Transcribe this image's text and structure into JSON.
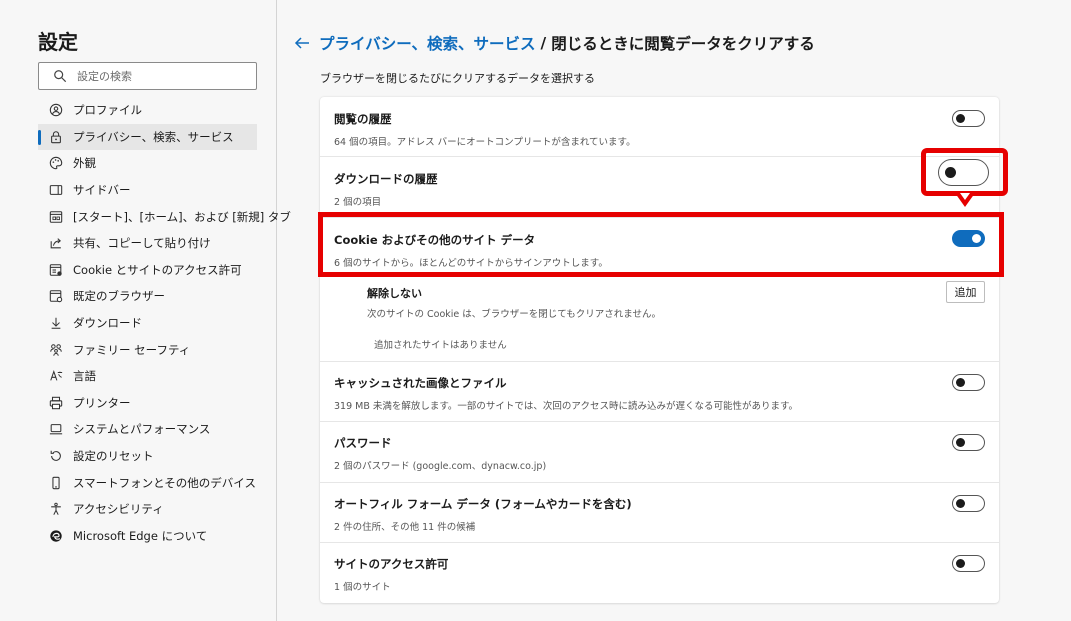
{
  "sidebar": {
    "title": "設定",
    "search_placeholder": "設定の検索",
    "items": [
      {
        "label": "プロファイル",
        "icon": "profile-icon"
      },
      {
        "label": "プライバシー、検索、サービス",
        "icon": "lock-icon",
        "active": true
      },
      {
        "label": "外観",
        "icon": "palette-icon"
      },
      {
        "label": "サイドバー",
        "icon": "sidebar-icon"
      },
      {
        "label": "[スタート]、[ホーム]、および [新規] タブ",
        "icon": "home-tab-icon"
      },
      {
        "label": "共有、コピーして貼り付け",
        "icon": "share-icon"
      },
      {
        "label": "Cookie とサイトのアクセス許可",
        "icon": "site-permissions-icon"
      },
      {
        "label": "既定のブラウザー",
        "icon": "browser-icon"
      },
      {
        "label": "ダウンロード",
        "icon": "download-icon"
      },
      {
        "label": "ファミリー セーフティ",
        "icon": "family-icon"
      },
      {
        "label": "言語",
        "icon": "language-icon"
      },
      {
        "label": "プリンター",
        "icon": "printer-icon"
      },
      {
        "label": "システムとパフォーマンス",
        "icon": "laptop-icon"
      },
      {
        "label": "設定のリセット",
        "icon": "reset-icon"
      },
      {
        "label": "スマートフォンとその他のデバイス",
        "icon": "phone-icon"
      },
      {
        "label": "アクセシビリティ",
        "icon": "accessibility-icon"
      },
      {
        "label": "Microsoft Edge について",
        "icon": "edge-icon"
      }
    ]
  },
  "header": {
    "breadcrumb_link": "プライバシー、検索、サービス",
    "separator": "/",
    "current": "閉じるときに閲覧データをクリアする"
  },
  "subtitle": "ブラウザーを閉じるたびにクリアするデータを選択する",
  "rows": [
    {
      "title": "閲覧の履歴",
      "desc": "64 個の項目。アドレス バーにオートコンプリートが含まれています。",
      "on": false
    },
    {
      "title": "ダウンロードの履歴",
      "desc": "2 個の項目",
      "on": false
    },
    {
      "title": "Cookie およびその他のサイト データ",
      "desc": "6 個のサイトから。ほとんどのサイトからサインアウトします。",
      "on": true
    },
    {
      "title": "キャッシュされた画像とファイル",
      "desc": "319 MB 未満を解放します。一部のサイトでは、次回のアクセス時に読み込みが遅くなる可能性があります。",
      "on": false
    },
    {
      "title": "パスワード",
      "desc": "2 個のパスワード (google.com、dynacw.co.jp)",
      "on": false
    },
    {
      "title": "オートフィル フォーム データ (フォームやカードを含む)",
      "desc": "2 件の住所、その他 11 件の候補",
      "on": false
    },
    {
      "title": "サイトのアクセス許可",
      "desc": "1 個のサイト",
      "on": false
    }
  ],
  "exceptions": {
    "title": "解除しない",
    "desc": "次のサイトの Cookie は、ブラウザーを閉じてもクリアされません。",
    "add_label": "追加",
    "empty_text": "追加されたサイトはありません"
  },
  "colors": {
    "accent": "#0f6cbd",
    "annotation": "#e60000"
  }
}
